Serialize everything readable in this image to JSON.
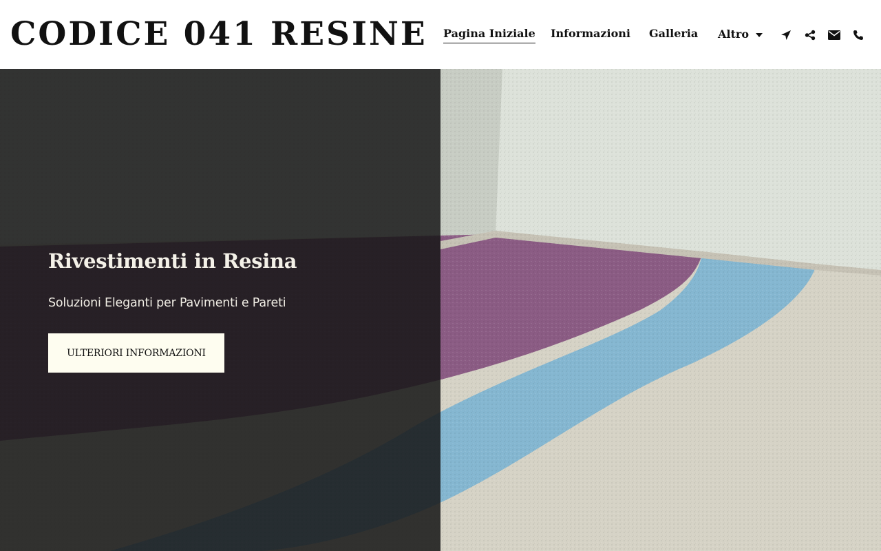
{
  "header": {
    "logo": "CODICE 041 RESINE",
    "nav": {
      "home": "Pagina Iniziale",
      "about": "Informazioni",
      "gallery": "Galleria",
      "more": "Altro"
    },
    "icons": [
      "location-arrow-icon",
      "share-icon",
      "envelope-icon",
      "phone-icon"
    ]
  },
  "hero": {
    "title": "Rivestimenti in Resina",
    "subtitle": "Soluzioni Eleganti per Pavimenti e Pareti",
    "cta_label": "ULTERIORI INFORMAZIONI"
  },
  "colors": {
    "overlay": "#161616",
    "cta_background": "#fefdf0",
    "floor_purple": "#8a5a80",
    "floor_blue": "#7fb3cf",
    "floor_beige": "#d9d6c8"
  }
}
